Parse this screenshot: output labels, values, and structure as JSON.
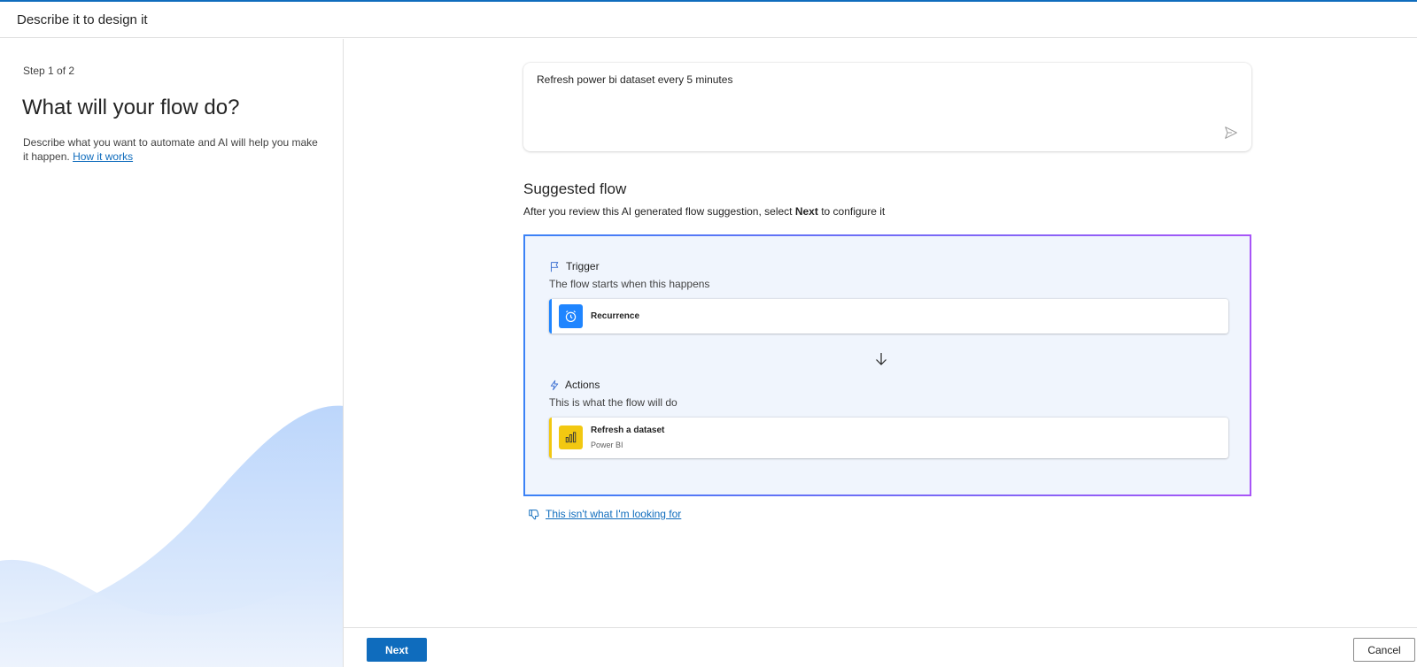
{
  "header": {
    "title": "Describe it to design it"
  },
  "left": {
    "step": "Step 1 of 2",
    "heading": "What will your flow do?",
    "description": "Describe what you want to automate and AI will help you make it happen.",
    "link": "How it works"
  },
  "prompt": {
    "value": "Refresh power bi dataset every 5 minutes",
    "send_icon": "send-icon"
  },
  "suggested": {
    "title": "Suggested flow",
    "subtitle_pre": "After you review this AI generated flow suggestion, select ",
    "subtitle_bold": "Next",
    "subtitle_post": " to configure it",
    "trigger": {
      "title": "Trigger",
      "subtitle": "The flow starts when this happens",
      "card": {
        "label": "Recurrence",
        "icon": "alarm-clock-icon",
        "color": "#1f85ff"
      }
    },
    "actions": {
      "title": "Actions",
      "subtitle": "This is what the flow will do",
      "card": {
        "label": "Refresh a dataset",
        "sublabel": "Power BI",
        "icon": "power-bi-icon",
        "color": "#f2c811"
      }
    }
  },
  "feedback": {
    "label": "This isn't what I'm looking for"
  },
  "footer": {
    "next_label": "Next",
    "cancel_label": "Cancel"
  },
  "colors": {
    "accent": "#0f6cbd",
    "flow_bg": "#f0f5fd",
    "trigger_bar": "#1f85ff",
    "action_bar": "#f2c811"
  }
}
